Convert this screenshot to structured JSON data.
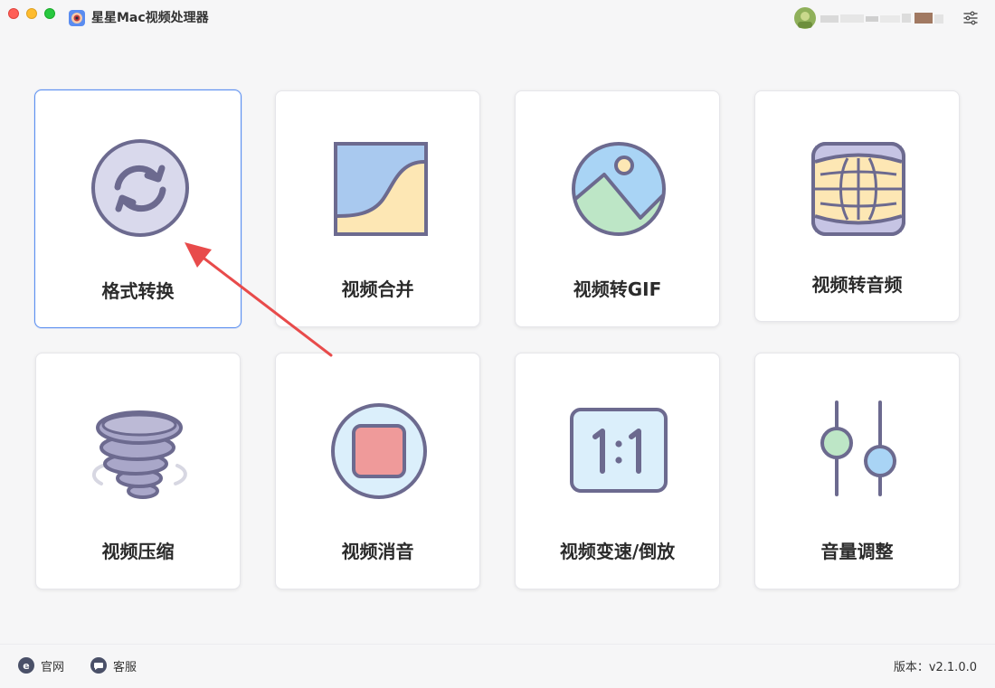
{
  "app": {
    "title": "星星Mac视频处理器"
  },
  "header": {
    "user_name": ""
  },
  "tools": [
    {
      "label": "格式转换",
      "icon": "format-convert-icon"
    },
    {
      "label": "视频合并",
      "icon": "video-merge-icon"
    },
    {
      "label": "视频转GIF",
      "icon": "image-gif-icon"
    },
    {
      "label": "视频转音频",
      "icon": "globe-audio-icon"
    },
    {
      "label": "视频压缩",
      "icon": "tornado-compress-icon"
    },
    {
      "label": "视频消音",
      "icon": "stop-mute-icon"
    },
    {
      "label": "视频变速/倒放",
      "icon": "ratio-speed-icon"
    },
    {
      "label": "音量调整",
      "icon": "sliders-volume-icon"
    }
  ],
  "footer": {
    "website_label": "官网",
    "support_label": "客服",
    "version": "版本：v2.1.0.0"
  },
  "colors": {
    "accent": "#5b8ff0",
    "arrow": "#e84b4b",
    "icon_stroke": "#6c6a8f"
  }
}
